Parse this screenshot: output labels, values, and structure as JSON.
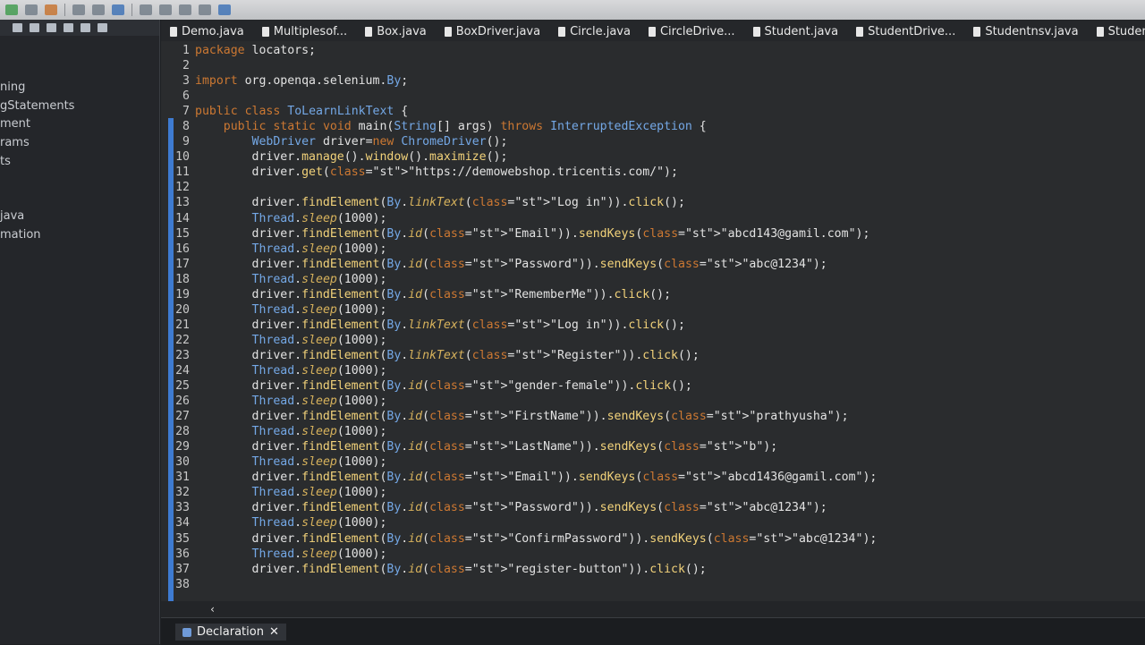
{
  "tabs": [
    {
      "label": "Demo.java"
    },
    {
      "label": "Multiplesof..."
    },
    {
      "label": "Box.java"
    },
    {
      "label": "BoxDriver.java"
    },
    {
      "label": "Circle.java"
    },
    {
      "label": "CircleDrive..."
    },
    {
      "label": "Student.java"
    },
    {
      "label": "StudentDrive..."
    },
    {
      "label": "Studentnsv.java"
    },
    {
      "label": "Studentns"
    }
  ],
  "tree": [
    "ning",
    "gStatements",
    "ment",
    "rams",
    "ts",
    "java",
    "mation"
  ],
  "declaration": {
    "label": "Declaration",
    "close": "✕"
  },
  "scroll_arrow": "‹",
  "code_lines": [
    {
      "n": "1",
      "t": "package locators;"
    },
    {
      "n": "2",
      "t": ""
    },
    {
      "n": "3",
      "t": "import org.openqa.selenium.By;"
    },
    {
      "n": "6",
      "t": ""
    },
    {
      "n": "7",
      "t": "public class ToLearnLinkText {"
    },
    {
      "n": "8",
      "t": "    public static void main(String[] args) throws InterruptedException {"
    },
    {
      "n": "9",
      "t": "        WebDriver driver=new ChromeDriver();"
    },
    {
      "n": "10",
      "t": "        driver.manage().window().maximize();"
    },
    {
      "n": "11",
      "t": "        driver.get(\"https://demowebshop.tricentis.com/\");"
    },
    {
      "n": "12",
      "t": ""
    },
    {
      "n": "13",
      "t": "        driver.findElement(By.linkText(\"Log in\")).click();"
    },
    {
      "n": "14",
      "t": "        Thread.sleep(1000);"
    },
    {
      "n": "15",
      "t": "        driver.findElement(By.id(\"Email\")).sendKeys(\"abcd143@gamil.com\");"
    },
    {
      "n": "16",
      "t": "        Thread.sleep(1000);"
    },
    {
      "n": "17",
      "t": "        driver.findElement(By.id(\"Password\")).sendKeys(\"abc@1234\");"
    },
    {
      "n": "18",
      "t": "        Thread.sleep(1000);"
    },
    {
      "n": "19",
      "t": "        driver.findElement(By.id(\"RememberMe\")).click();"
    },
    {
      "n": "20",
      "t": "        Thread.sleep(1000);"
    },
    {
      "n": "21",
      "t": "        driver.findElement(By.linkText(\"Log in\")).click();"
    },
    {
      "n": "22",
      "t": "        Thread.sleep(1000);"
    },
    {
      "n": "23",
      "t": "        driver.findElement(By.linkText(\"Register\")).click();"
    },
    {
      "n": "24",
      "t": "        Thread.sleep(1000);"
    },
    {
      "n": "25",
      "t": "        driver.findElement(By.id(\"gender-female\")).click();"
    },
    {
      "n": "26",
      "t": "        Thread.sleep(1000);"
    },
    {
      "n": "27",
      "t": "        driver.findElement(By.id(\"FirstName\")).sendKeys(\"prathyusha\");"
    },
    {
      "n": "28",
      "t": "        Thread.sleep(1000);"
    },
    {
      "n": "29",
      "t": "        driver.findElement(By.id(\"LastName\")).sendKeys(\"b\");"
    },
    {
      "n": "30",
      "t": "        Thread.sleep(1000);"
    },
    {
      "n": "31",
      "t": "        driver.findElement(By.id(\"Email\")).sendKeys(\"abcd1436@gamil.com\");"
    },
    {
      "n": "32",
      "t": "        Thread.sleep(1000);"
    },
    {
      "n": "33",
      "t": "        driver.findElement(By.id(\"Password\")).sendKeys(\"abc@1234\");"
    },
    {
      "n": "34",
      "t": "        Thread.sleep(1000);"
    },
    {
      "n": "35",
      "t": "        driver.findElement(By.id(\"ConfirmPassword\")).sendKeys(\"abc@1234\");"
    },
    {
      "n": "36",
      "t": "        Thread.sleep(1000);"
    },
    {
      "n": "37",
      "t": "        driver.findElement(By.id(\"register-button\")).click();"
    },
    {
      "n": "38",
      "t": ""
    }
  ]
}
